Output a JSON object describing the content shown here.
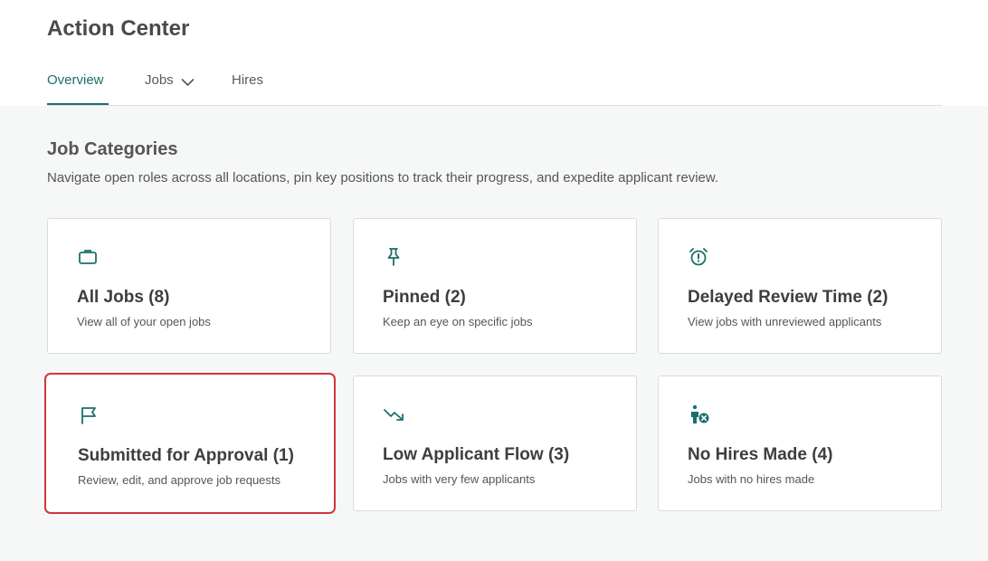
{
  "header": {
    "title": "Action Center"
  },
  "tabs": [
    {
      "label": "Overview",
      "active": true
    },
    {
      "label": "Jobs",
      "has_dropdown": true
    },
    {
      "label": "Hires"
    }
  ],
  "section": {
    "title": "Job Categories",
    "description": "Navigate open roles across all locations, pin key positions to track their progress, and expedite applicant review."
  },
  "cards": [
    {
      "title": "All Jobs (8)",
      "description": "View all of your open jobs",
      "icon": "briefcase-icon"
    },
    {
      "title": "Pinned (2)",
      "description": "Keep an eye on specific jobs",
      "icon": "pin-icon"
    },
    {
      "title": "Delayed Review Time (2)",
      "description": "View jobs with unreviewed applicants",
      "icon": "alarm-clock-icon"
    },
    {
      "title": "Submitted for Approval (1)",
      "description": "Review, edit, and approve job requests",
      "icon": "flag-icon",
      "selected": true
    },
    {
      "title": "Low Applicant Flow (3)",
      "description": "Jobs with very few applicants",
      "icon": "trending-down-icon"
    },
    {
      "title": "No Hires Made (4)",
      "description": "Jobs with no hires made",
      "icon": "person-x-icon"
    }
  ],
  "colors": {
    "accent": "#1c6f6f",
    "selected_border": "#d0363b",
    "background": "#f6f7f7"
  }
}
